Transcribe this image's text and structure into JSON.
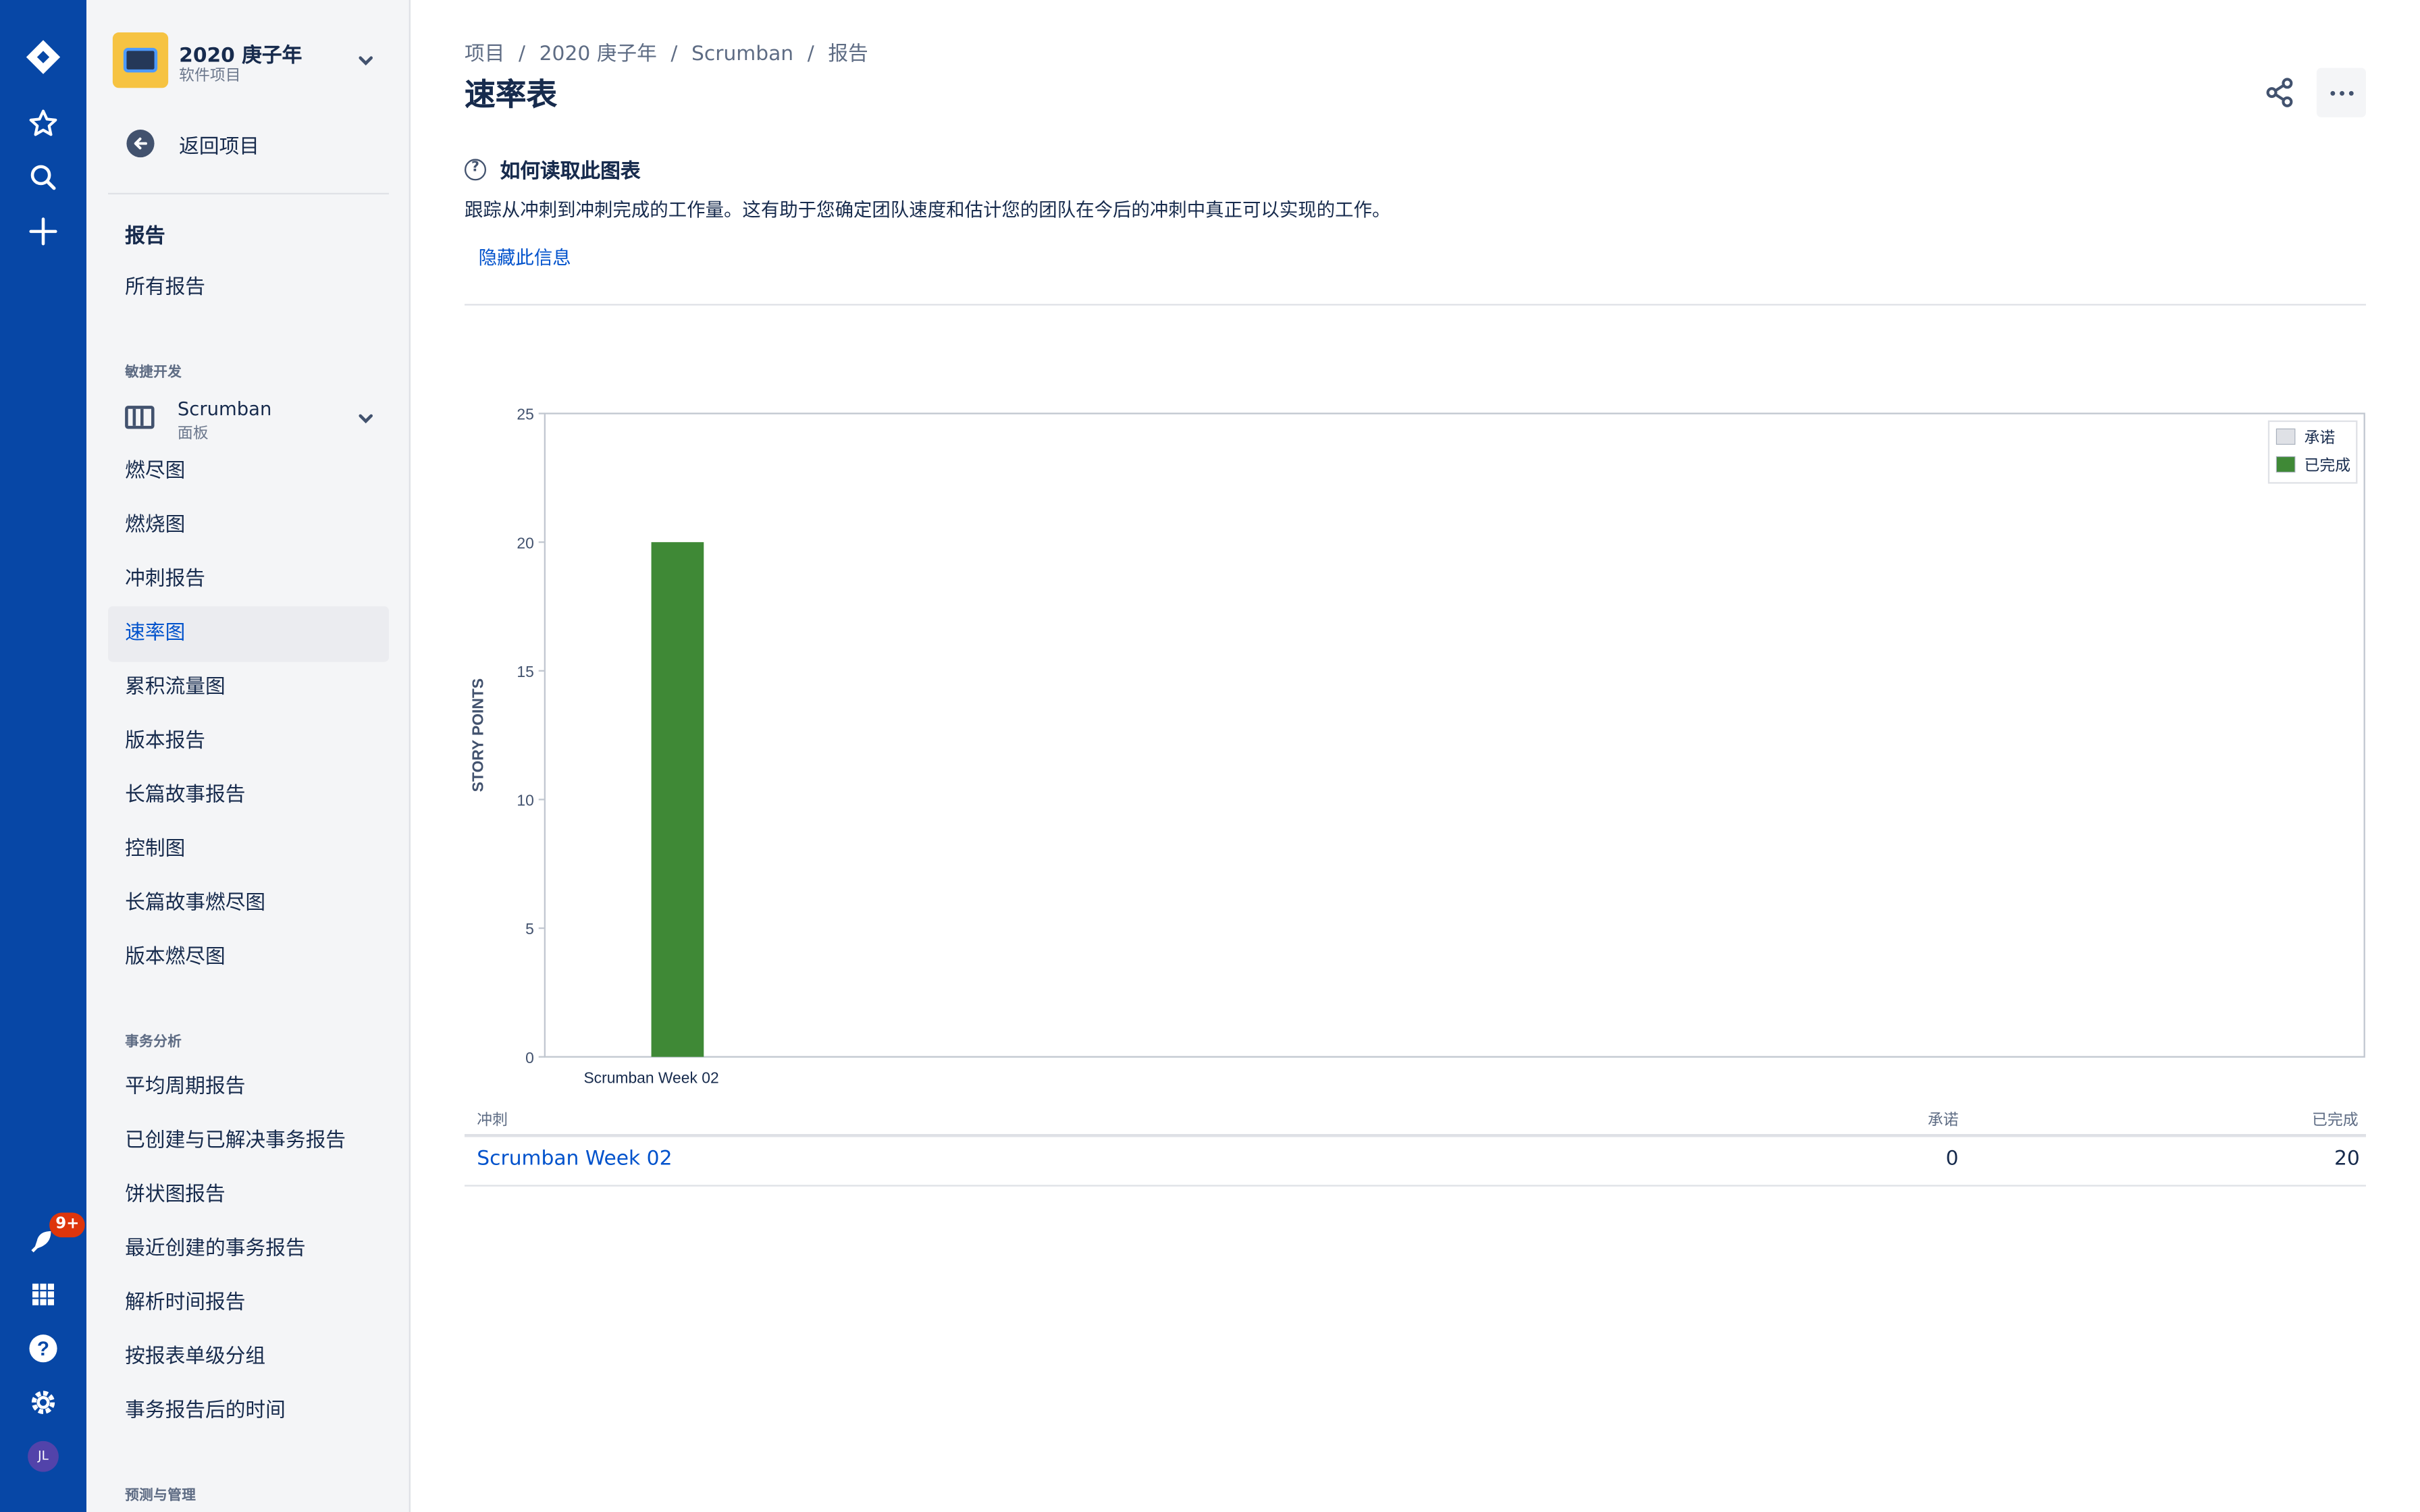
{
  "nav": {
    "notification_count": "9+",
    "avatar_initials": "JL",
    "brand_color": "#0747A6"
  },
  "project": {
    "name": "2020 庚子年",
    "type": "软件项目"
  },
  "sidebar": {
    "back_label": "返回项目",
    "reports_heading": "报告",
    "all_reports": "所有报告",
    "agile_group": "敏捷开发",
    "board_name": "Scrumban",
    "board_type": "面板",
    "agile_items": [
      "燃尽图",
      "燃烧图",
      "冲刺报告",
      "速率图",
      "累积流量图",
      "版本报告",
      "长篇故事报告",
      "控制图",
      "长篇故事燃尽图",
      "版本燃尽图"
    ],
    "active_item": "速率图",
    "issue_group": "事务分析",
    "issue_items": [
      "平均周期报告",
      "已创建与已解决事务报告",
      "饼状图报告",
      "最近创建的事务报告",
      "解析时间报告",
      "按报表单级分组",
      "事务报告后的时间"
    ],
    "forecast_group": "预测与管理"
  },
  "breadcrumbs": [
    "项目",
    "2020 庚子年",
    "Scrumban",
    "报告"
  ],
  "page": {
    "title": "速率表",
    "help_heading": "如何读取此图表",
    "help_text": "跟踪从冲刺到冲刺完成的工作量。这有助于您确定团队速度和估计您的团队在今后的冲刺中真正可以实现的工作。",
    "hide_link": "隐藏此信息"
  },
  "chart_data": {
    "type": "bar",
    "categories": [
      "Scrumban Week 02"
    ],
    "series": [
      {
        "name": "承诺",
        "values": [
          0
        ],
        "color": "#DFE1E6"
      },
      {
        "name": "已完成",
        "values": [
          20
        ],
        "color": "#3F8936"
      }
    ],
    "ylabel": "STORY POINTS",
    "xlabel": "",
    "ylim": [
      0,
      25
    ],
    "yticks": [
      0,
      5,
      10,
      15,
      20,
      25
    ],
    "legend_position": "top-right",
    "grid": false
  },
  "table": {
    "headers": {
      "sprint": "冲刺",
      "commitment": "承诺",
      "completed": "已完成"
    },
    "rows": [
      {
        "sprint": "Scrumban Week 02",
        "commitment": "0",
        "completed": "20"
      }
    ]
  }
}
